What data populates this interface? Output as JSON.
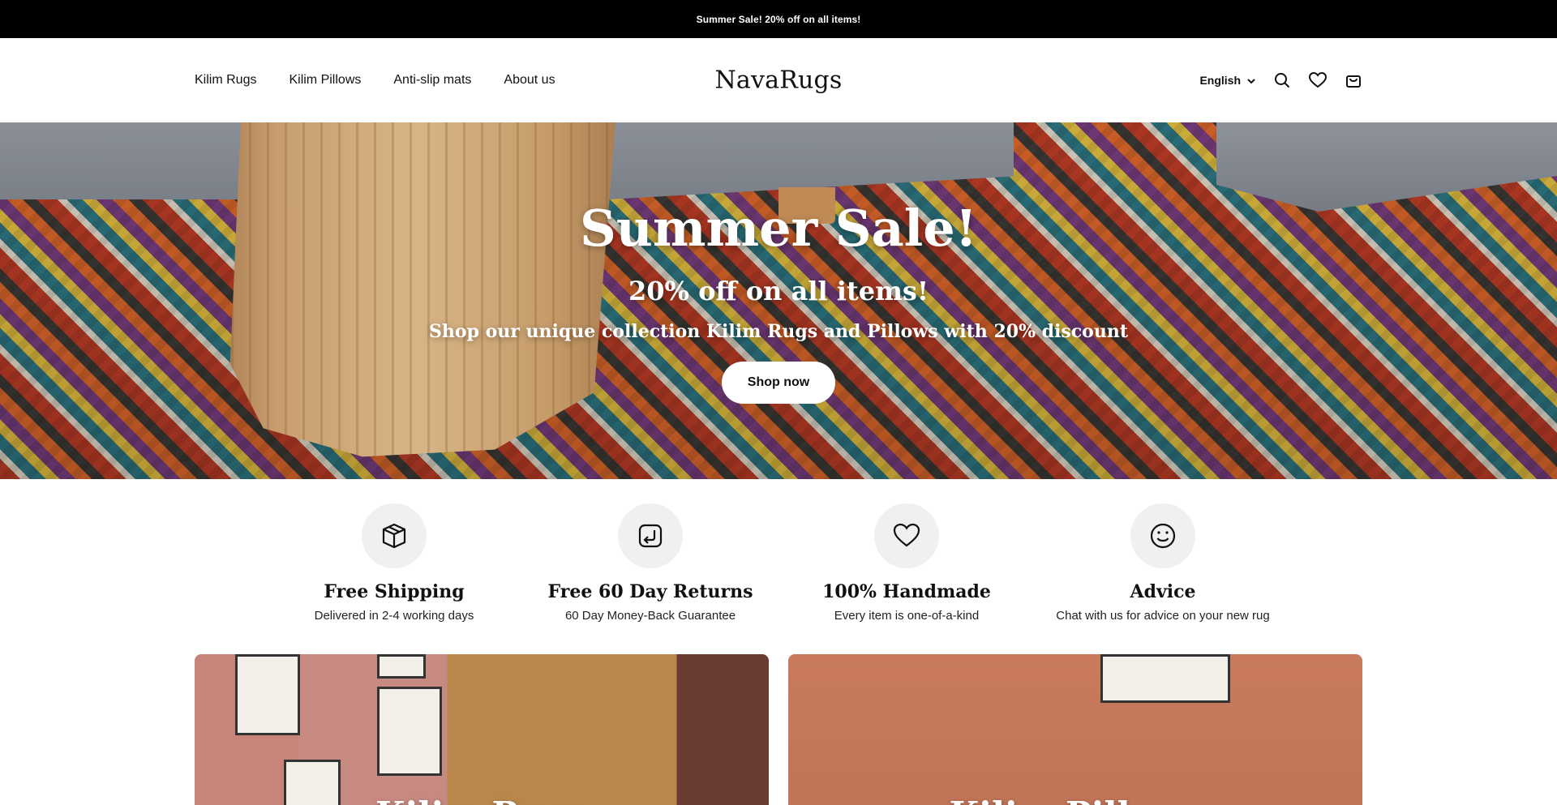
{
  "announcement": {
    "text": "Summer Sale! 20% off on all items!"
  },
  "header": {
    "nav": [
      {
        "label": "Kilim Rugs"
      },
      {
        "label": "Kilim Pillows"
      },
      {
        "label": "Anti-slip mats"
      },
      {
        "label": "About us"
      }
    ],
    "logo": "NavaRugs",
    "language": "English",
    "icons": [
      "search-icon",
      "heart-icon",
      "cart-icon"
    ]
  },
  "hero": {
    "title": "Summer Sale!",
    "subtitle": "20% off on all items!",
    "description": "Shop our unique collection Kilim Rugs and Pillows with 20% discount",
    "button": "Shop now"
  },
  "features": [
    {
      "icon": "box-icon",
      "title": "Free Shipping",
      "desc": "Delivered in 2-4 working days"
    },
    {
      "icon": "return-icon",
      "title": "Free 60 Day Returns",
      "desc": "60 Day Money-Back Guarantee"
    },
    {
      "icon": "heart-icon",
      "title": "100% Handmade",
      "desc": "Every item is one-of-a-kind"
    },
    {
      "icon": "smile-icon",
      "title": "Advice",
      "desc": "Chat with us for advice on your new rug"
    }
  ],
  "collections": [
    {
      "title": "Kilim Rugs"
    },
    {
      "title": "Kilim Pillows"
    }
  ]
}
